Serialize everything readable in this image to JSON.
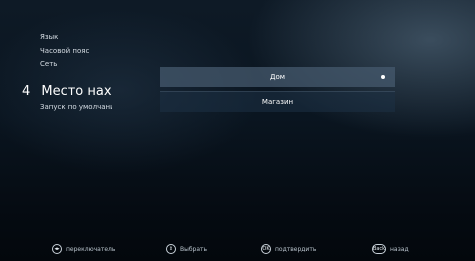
{
  "menu": {
    "items": [
      {
        "label": "Язык"
      },
      {
        "label": "Часовой пояс"
      },
      {
        "label": "Сеть"
      }
    ],
    "active": {
      "number": "4",
      "label": "Место нахождения"
    },
    "after": {
      "label": "Запуск по умолчанию"
    }
  },
  "options": [
    {
      "label": "Дом",
      "selected": true
    },
    {
      "label": "Магазин",
      "selected": false
    }
  ],
  "hints": [
    {
      "icon": "dpad-left-right-icon",
      "glyph": "◂▸",
      "label": "переключатель"
    },
    {
      "icon": "dpad-up-down-icon",
      "glyph": "⇕",
      "label": "Выбрать"
    },
    {
      "icon": "ok-button-icon",
      "glyph": "OK",
      "label": "подтвердить"
    },
    {
      "icon": "back-button-icon",
      "glyph": "Back",
      "label": "назад"
    }
  ]
}
